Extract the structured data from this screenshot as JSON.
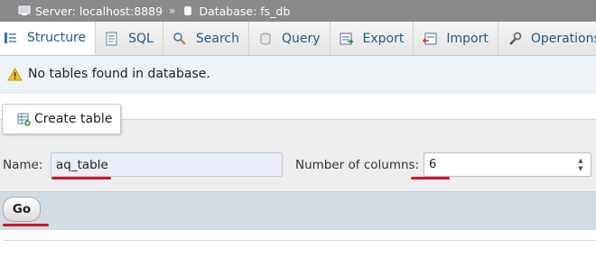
{
  "breadcrumb": {
    "server_label": "Server: localhost:8889",
    "separator": "»",
    "database_label": "Database: fs_db",
    "server_icon": "server-icon",
    "database_icon": "database-icon"
  },
  "tabs": [
    {
      "label": "Structure",
      "icon": "structure-icon",
      "active": true
    },
    {
      "label": "SQL",
      "icon": "sql-icon"
    },
    {
      "label": "Search",
      "icon": "search-icon"
    },
    {
      "label": "Query",
      "icon": "query-icon"
    },
    {
      "label": "Export",
      "icon": "export-icon"
    },
    {
      "label": "Import",
      "icon": "import-icon"
    },
    {
      "label": "Operations",
      "icon": "operations-icon"
    }
  ],
  "notice": {
    "icon": "warning-icon",
    "text": "No tables found in database."
  },
  "create_table": {
    "legend": "Create table",
    "icon": "create-table-icon",
    "name_label": "Name:",
    "name_value": "aq_table",
    "columns_label": "Number of columns:",
    "columns_value": "6",
    "go_label": "Go"
  },
  "colors": {
    "breadcrumb_bg": "#8a8a8a",
    "tab_text": "#235a81",
    "annotation_red": "#d0142c",
    "go_bar_bg": "#d3dce3"
  }
}
